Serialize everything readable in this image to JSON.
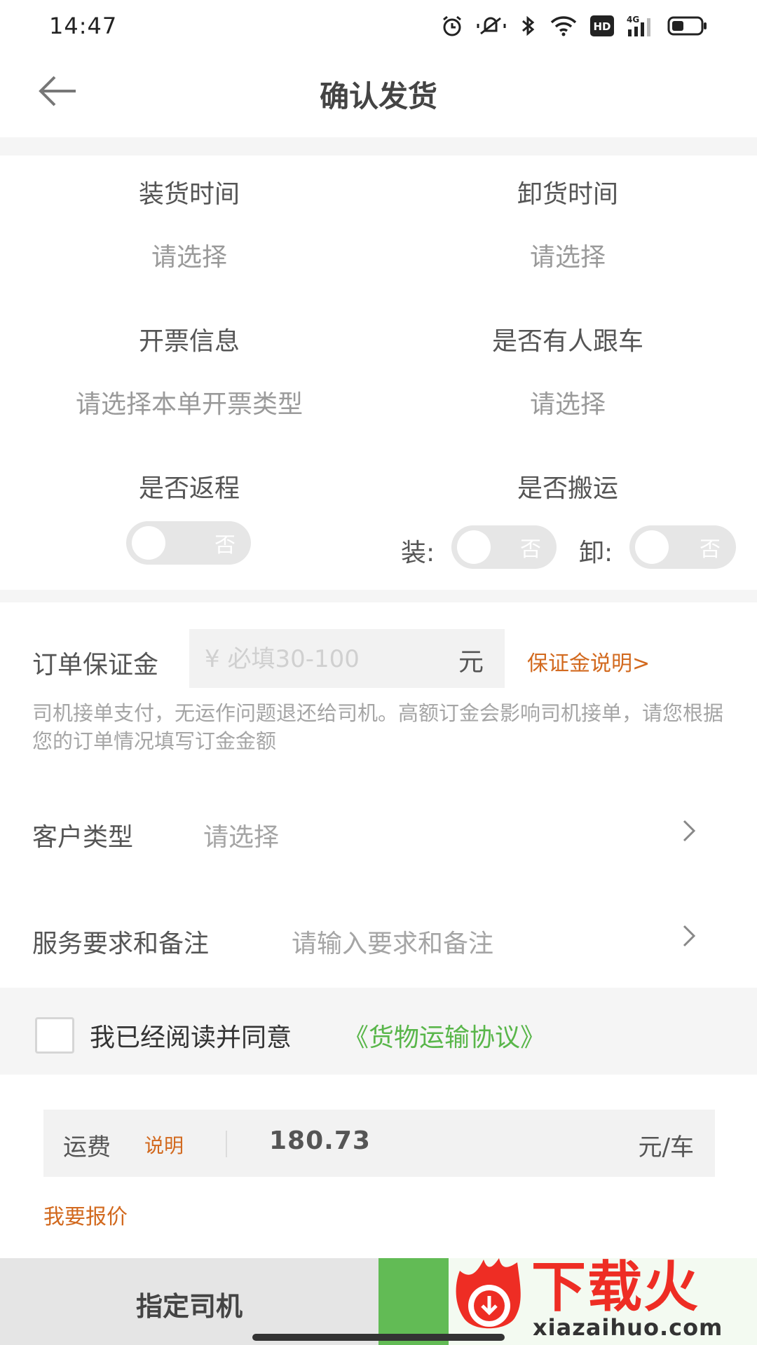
{
  "status_bar": {
    "time": "14:47",
    "hd": "HD",
    "network": "4G"
  },
  "nav": {
    "title": "确认发货"
  },
  "form": {
    "load_time": {
      "label": "装货时间",
      "value": "请选择"
    },
    "unload_time": {
      "label": "卸货时间",
      "value": "请选择"
    },
    "invoice": {
      "label": "开票信息",
      "value": "请选择本单开票类型"
    },
    "escort": {
      "label": "是否有人跟车",
      "value": "请选择"
    },
    "return_trip": {
      "label": "是否返程",
      "toggle": "否"
    },
    "handling": {
      "label": "是否搬运",
      "load_label": "装:",
      "load_toggle": "否",
      "unload_label": "卸:",
      "unload_toggle": "否"
    }
  },
  "deposit": {
    "label": "订单保证金",
    "placeholder": "¥ 必填30-100",
    "unit": "元",
    "link": "保证金说明>",
    "description": "司机接单支付，无运作问题退还给司机。高额订金会影响司机接单，请您根据您的订单情况填写订金金额"
  },
  "customer_type": {
    "label": "客户类型",
    "value": "请选择"
  },
  "service_notes": {
    "label": "服务要求和备注",
    "value": "请输入要求和备注"
  },
  "agreement": {
    "text": "我已经阅读并同意",
    "link": "《货物运输协议》"
  },
  "freight": {
    "label": "运费",
    "explain": "说明",
    "amount": "180.73",
    "unit": "元/车",
    "quote_link": "我要报价"
  },
  "bottom_bar": {
    "assign_driver": "指定司机",
    "confirm": ""
  },
  "watermark": {
    "brand": "下载火",
    "url": "xiazaihuo.com"
  },
  "colors": {
    "accent_green": "#62bb55",
    "link_orange": "#d2691e",
    "link_green": "#59b64a"
  },
  "icons": [
    "alarm-icon",
    "mute-icon",
    "bluetooth-icon",
    "wifi-icon",
    "hd-icon",
    "signal-icon",
    "battery-icon",
    "back-arrow-icon",
    "chevron-right-icon"
  ]
}
